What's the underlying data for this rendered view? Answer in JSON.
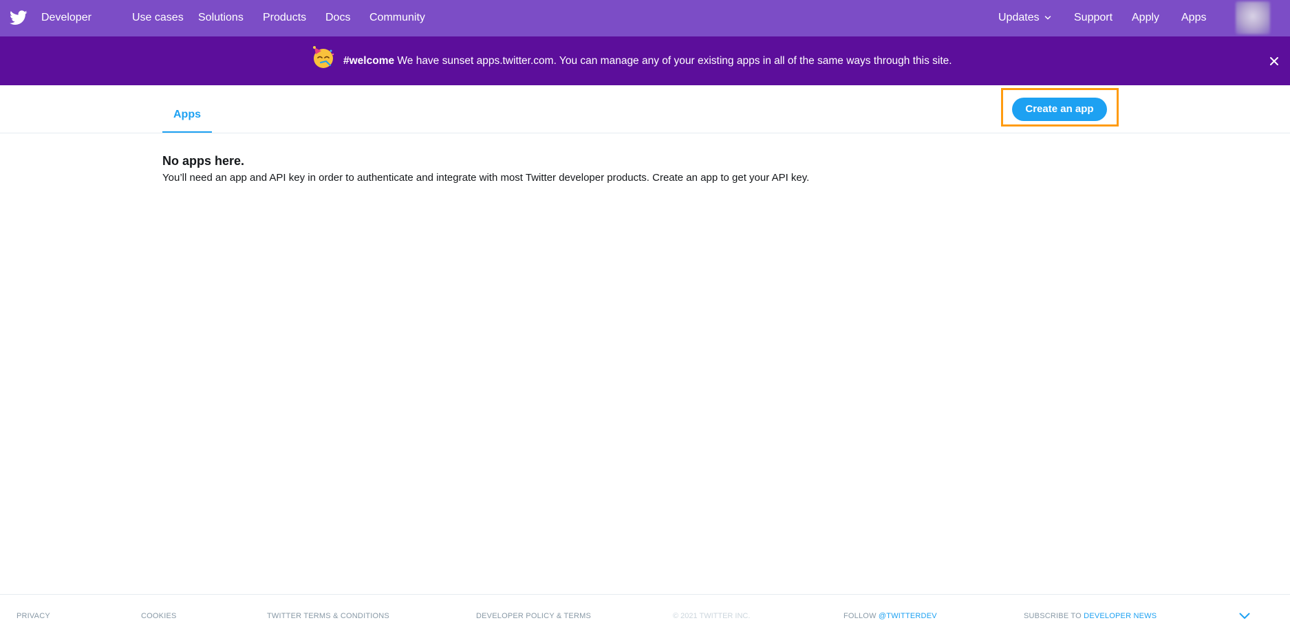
{
  "nav": {
    "brand": "Developer",
    "links": [
      "Use cases",
      "Solutions",
      "Products",
      "Docs",
      "Community"
    ],
    "right": {
      "updates": "Updates",
      "support": "Support",
      "apply": "Apply",
      "apps": "Apps"
    },
    "bg_color": "#7c4dc6"
  },
  "banner": {
    "hashtag": "#welcome",
    "message": " We have sunset apps.twitter.com. You can manage any of your existing apps in all of the same ways through this site.",
    "bg_color": "#5c0e9b"
  },
  "tabs": {
    "active": "Apps"
  },
  "actions": {
    "create_app": "Create an app"
  },
  "empty_state": {
    "title": "No apps here.",
    "description": "You’ll need an app and API key in order to authenticate and integrate with most Twitter developer products. Create an app to get your API key."
  },
  "footer": {
    "privacy": "Privacy",
    "cookies": "Cookies",
    "terms": "Twitter Terms & Conditions",
    "policy": "Developer Policy & Terms",
    "copyright": "© 2021 Twitter Inc.",
    "follow_prefix": "Follow ",
    "follow_handle": "@TwitterDev",
    "subscribe_prefix": "Subscribe to ",
    "subscribe_link": "Developer News"
  },
  "colors": {
    "accent": "#1da1f2",
    "highlight": "#ff9b0f"
  }
}
